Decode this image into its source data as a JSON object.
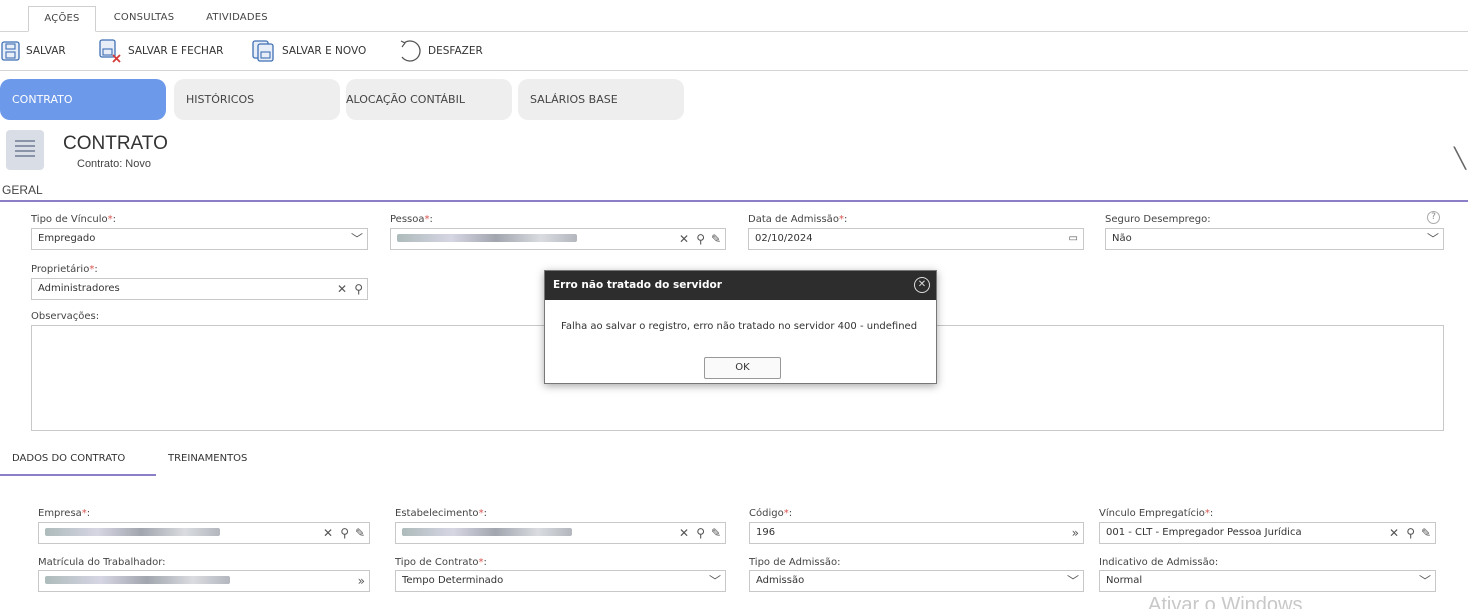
{
  "ribbon": {
    "tabs": [
      "AÇÕES",
      "CONSULTAS",
      "ATIVIDADES"
    ]
  },
  "toolbar": {
    "save": "SALVAR",
    "save_close": "SALVAR E FECHAR",
    "save_new": "SALVAR E NOVO",
    "undo": "DESFAZER"
  },
  "main_tabs": [
    "CONTRATO",
    "HISTÓRICOS",
    "ALOCAÇÃO CONTÁBIL",
    "SALÁRIOS BASE"
  ],
  "header": {
    "title": "CONTRATO",
    "subtitle": "Contrato: Novo"
  },
  "section": {
    "geral": "GERAL"
  },
  "fields": {
    "tipo_vinculo": {
      "label": "Tipo de Vínculo",
      "value": "Empregado"
    },
    "pessoa": {
      "label": "Pessoa"
    },
    "data_admissao": {
      "label": "Data de Admissão",
      "value": "02/10/2024"
    },
    "seguro_desemprego": {
      "label": "Seguro Desemprego:",
      "value": "Não"
    },
    "proprietario": {
      "label": "Proprietário",
      "value": "Administradores"
    },
    "observacoes": {
      "label": "Observações:"
    },
    "empresa": {
      "label": "Empresa"
    },
    "estabelecimento": {
      "label": "Estabelecimento"
    },
    "codigo": {
      "label": "Código",
      "value": "196"
    },
    "vinculo_empregaticio": {
      "label": "Vínculo Empregatício",
      "value": "001 - CLT - Empregador Pessoa Jurídica"
    },
    "matricula": {
      "label": "Matrícula do Trabalhador:"
    },
    "tipo_contrato": {
      "label": "Tipo de Contrato",
      "value": "Tempo Determinado"
    },
    "tipo_admissao": {
      "label": "Tipo de Admissão:",
      "value": "Admissão"
    },
    "indicativo_admissao": {
      "label": "Indicativo de Admissão:",
      "value": "Normal"
    }
  },
  "sub_tabs": [
    "DADOS DO CONTRATO",
    "TREINAMENTOS"
  ],
  "modal": {
    "title": "Erro não tratado do servidor",
    "message": "Falha ao salvar o registro, erro não tratado no servidor 400 - undefined",
    "ok": "OK"
  },
  "watermark": "Ativar o Windows"
}
